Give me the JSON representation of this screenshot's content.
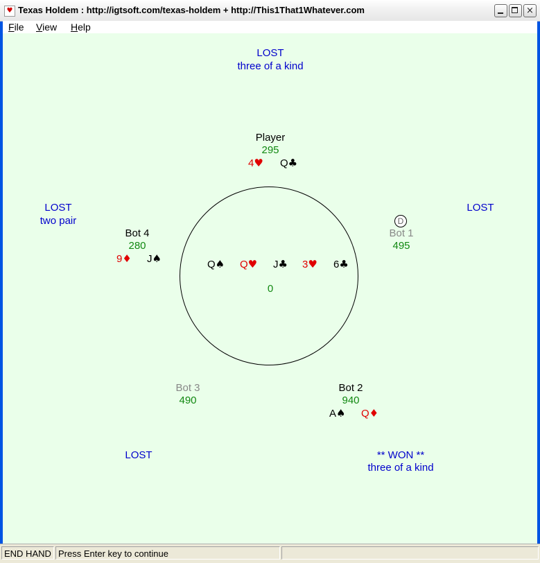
{
  "window": {
    "title": "Texas Holdem : http://igtsoft.com/texas-holdem + http://This1That1Whatever.com",
    "app_icon": "playing-card-icon",
    "close_glyph": "×"
  },
  "menu": {
    "file": {
      "mnemonic": "F",
      "rest": "ile"
    },
    "view": {
      "mnemonic": "V",
      "rest": "iew"
    },
    "help": {
      "mnemonic": "H",
      "rest": "elp"
    }
  },
  "players": {
    "player": {
      "name": "Player",
      "chips": "295",
      "result": "LOST",
      "hand": "three of a kind",
      "cards": [
        {
          "rank": "4",
          "suit": "♥"
        },
        {
          "rank": "Q",
          "suit": "♣"
        }
      ]
    },
    "bot1": {
      "name": "Bot 1",
      "chips": "495",
      "result": "LOST",
      "dealer_label": "D"
    },
    "bot2": {
      "name": "Bot 2",
      "chips": "940",
      "result": "** WON **",
      "hand": "three of a kind",
      "cards": [
        {
          "rank": "A",
          "suit": "♠"
        },
        {
          "rank": "Q",
          "suit": "♦"
        }
      ]
    },
    "bot3": {
      "name": "Bot 3",
      "chips": "490",
      "result": "LOST"
    },
    "bot4": {
      "name": "Bot 4",
      "chips": "280",
      "result": "LOST",
      "hand": "two pair",
      "cards": [
        {
          "rank": "9",
          "suit": "♦"
        },
        {
          "rank": "J",
          "suit": "♠"
        }
      ]
    }
  },
  "board": {
    "cards": [
      {
        "rank": "Q",
        "suit": "♠"
      },
      {
        "rank": "Q",
        "suit": "♥"
      },
      {
        "rank": "J",
        "suit": "♣"
      },
      {
        "rank": "3",
        "suit": "♥"
      },
      {
        "rank": "6",
        "suit": "♣"
      }
    ],
    "pot": "0"
  },
  "status": {
    "state": "END HAND",
    "message": "Press Enter key to continue",
    "extra": ""
  },
  "colors": {
    "felt": "#eaffea",
    "result_text": "#0000cc",
    "chips_text": "#118811",
    "red_suit": "#e00000"
  }
}
